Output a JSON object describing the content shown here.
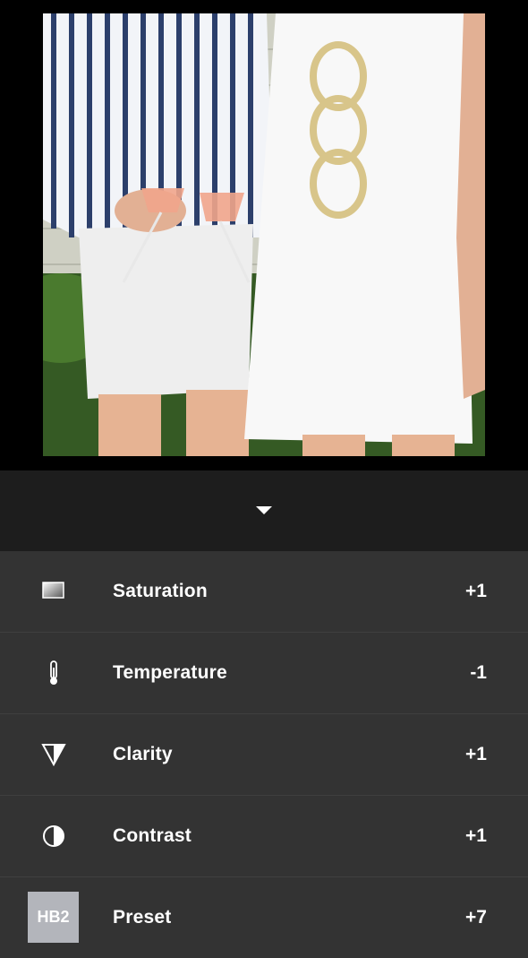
{
  "adjustments": [
    {
      "label": "Saturation",
      "value": "+1",
      "icon": "saturation-icon"
    },
    {
      "label": "Temperature",
      "value": "-1",
      "icon": "thermometer-icon"
    },
    {
      "label": "Clarity",
      "value": "+1",
      "icon": "clarity-triangle-icon"
    },
    {
      "label": "Contrast",
      "value": "+1",
      "icon": "contrast-icon"
    }
  ],
  "preset": {
    "thumb_label": "HB2",
    "label": "Preset",
    "value": "+7"
  }
}
